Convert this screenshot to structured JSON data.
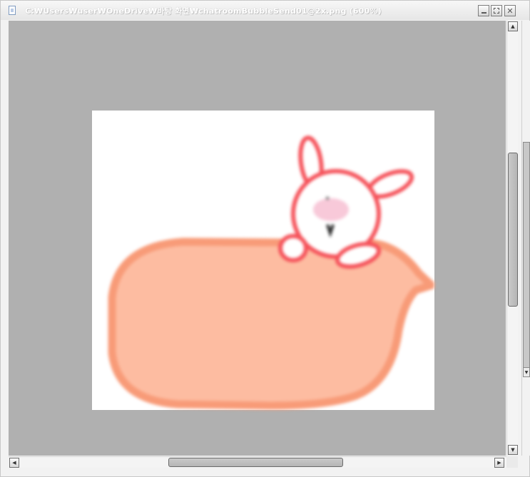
{
  "window": {
    "title": "C:₩Users₩user₩OneDrive₩바탕 화면₩chatroomBubbleSend01@2x.png (600%)"
  },
  "controls": {
    "minimize_icon": "minimize-icon",
    "maximize_icon": "maximize-icon",
    "close_glyph": "✕"
  },
  "scrollbars": {
    "up_arrow": "▲",
    "down_arrow": "▼",
    "left_arrow": "◀",
    "right_arrow": "▶"
  },
  "image": {
    "description_icon": "bunny-chat-bubble",
    "colors": {
      "bubble_fill": "#fdbca1",
      "bubble_stroke": "#f89b78",
      "bunny_outline": "#f5525a",
      "cheek": "#f8c9d9",
      "background": "#ffffff",
      "canvas": "#b0b0b0"
    }
  }
}
